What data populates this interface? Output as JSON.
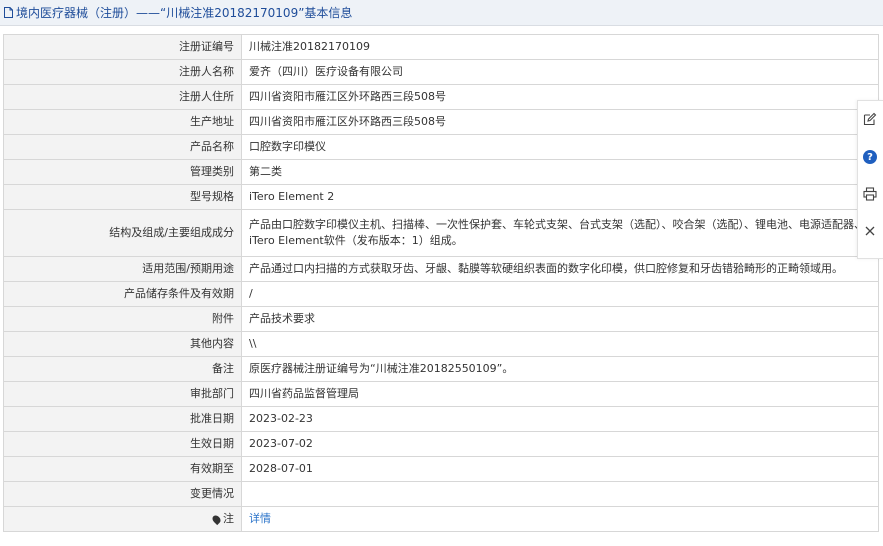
{
  "header": {
    "title": "境内医疗器械（注册）——“川械注准20182170109”基本信息"
  },
  "rows": [
    {
      "label": "注册证编号",
      "value": "川械注准20182170109"
    },
    {
      "label": "注册人名称",
      "value": "爱齐（四川）医疗设备有限公司"
    },
    {
      "label": "注册人住所",
      "value": "四川省资阳市雁江区外环路西三段508号"
    },
    {
      "label": "生产地址",
      "value": "四川省资阳市雁江区外环路西三段508号"
    },
    {
      "label": "产品名称",
      "value": "口腔数字印模仪"
    },
    {
      "label": "管理类别",
      "value": "第二类"
    },
    {
      "label": "型号规格",
      "value": "iTero Element 2"
    },
    {
      "label": "结构及组成/主要组成成分",
      "value": "产品由口腔数字印模仪主机、扫描棒、一次性保护套、车轮式支架、台式支架（选配）、咬合架（选配）、锂电池、电源适配器、iTero Element软件（发布版本：1）组成。"
    },
    {
      "label": "适用范围/预期用途",
      "value": "产品通过口内扫描的方式获取牙齿、牙龈、黏膜等软硬组织表面的数字化印模，供口腔修复和牙齿错𬌗畸形的正畸领域用。"
    },
    {
      "label": "产品储存条件及有效期",
      "value": "/"
    },
    {
      "label": "附件",
      "value": "产品技术要求"
    },
    {
      "label": "其他内容",
      "value": "\\\\"
    },
    {
      "label": "备注",
      "value": "原医疗器械注册证编号为“川械注准20182550109”。"
    },
    {
      "label": "审批部门",
      "value": "四川省药品监督管理局"
    },
    {
      "label": "批准日期",
      "value": "2023-02-23"
    },
    {
      "label": "生效日期",
      "value": "2023-07-02"
    },
    {
      "label": "有效期至",
      "value": "2028-07-01"
    },
    {
      "label": "变更情况",
      "value": ""
    },
    {
      "label": "注",
      "value": "详情"
    }
  ],
  "icons": {
    "doc": "document-icon",
    "pin": "pin-icon",
    "side": [
      "edit-icon",
      "help-icon",
      "print-icon",
      "close-icon"
    ]
  },
  "colors": {
    "header_bg": "#eef2f7",
    "title": "#1f4d9a",
    "link": "#2a73c9",
    "help": "#1f5fbf"
  }
}
